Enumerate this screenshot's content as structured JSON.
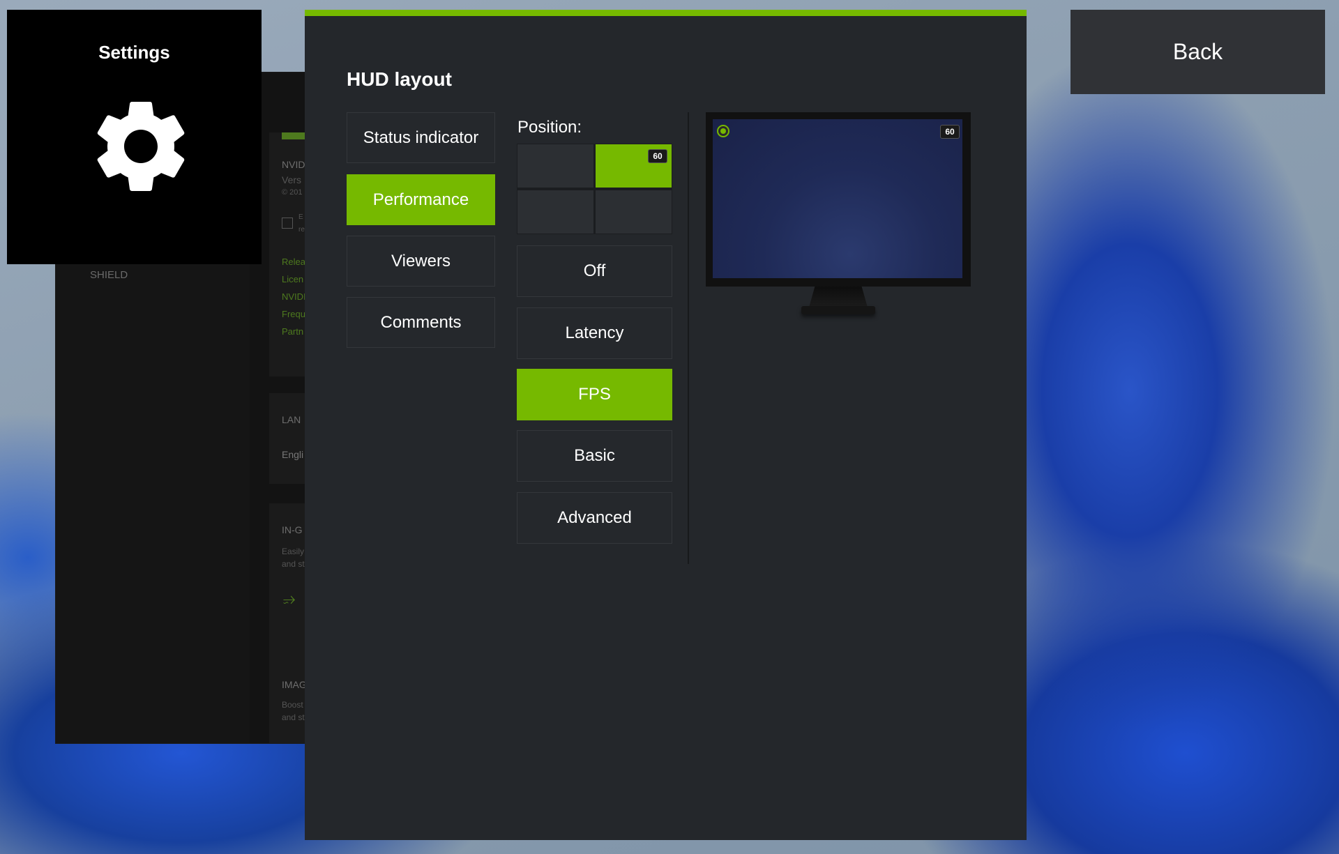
{
  "background_app": {
    "sidebar_label": "SHIELD",
    "about_title": "NVID",
    "about_version": "Vers",
    "about_copyright": "© 201",
    "links": [
      "Relea",
      "Licen",
      "NVIDI",
      "Frequ",
      "Partn"
    ],
    "checkbox_text_1": "E",
    "checkbox_text_2": "re",
    "language_title": "LAN",
    "language_value": "Engli",
    "ingame_title": "IN-G",
    "ingame_desc_1": "Easily",
    "ingame_desc_2": "and st",
    "image_title": "IMAG",
    "image_desc_1": "Boost",
    "image_desc_2": "and st"
  },
  "settings_tile": {
    "title": "Settings",
    "icon": "gear-icon"
  },
  "back_button": {
    "label": "Back"
  },
  "hud": {
    "heading": "HUD layout",
    "categories": [
      {
        "label": "Status indicator",
        "active": false
      },
      {
        "label": "Performance",
        "active": true
      },
      {
        "label": "Viewers",
        "active": false
      },
      {
        "label": "Comments",
        "active": false
      }
    ],
    "position_label": "Position:",
    "position_selected": "top-right",
    "position_badge": "60",
    "modes": [
      {
        "label": "Off",
        "active": false
      },
      {
        "label": "Latency",
        "active": false
      },
      {
        "label": "FPS",
        "active": true
      },
      {
        "label": "Basic",
        "active": false
      },
      {
        "label": "Advanced",
        "active": false
      }
    ],
    "preview_badge": "60"
  },
  "colors": {
    "accent": "#76b900",
    "panel": "#24272b",
    "button": "#303236"
  }
}
